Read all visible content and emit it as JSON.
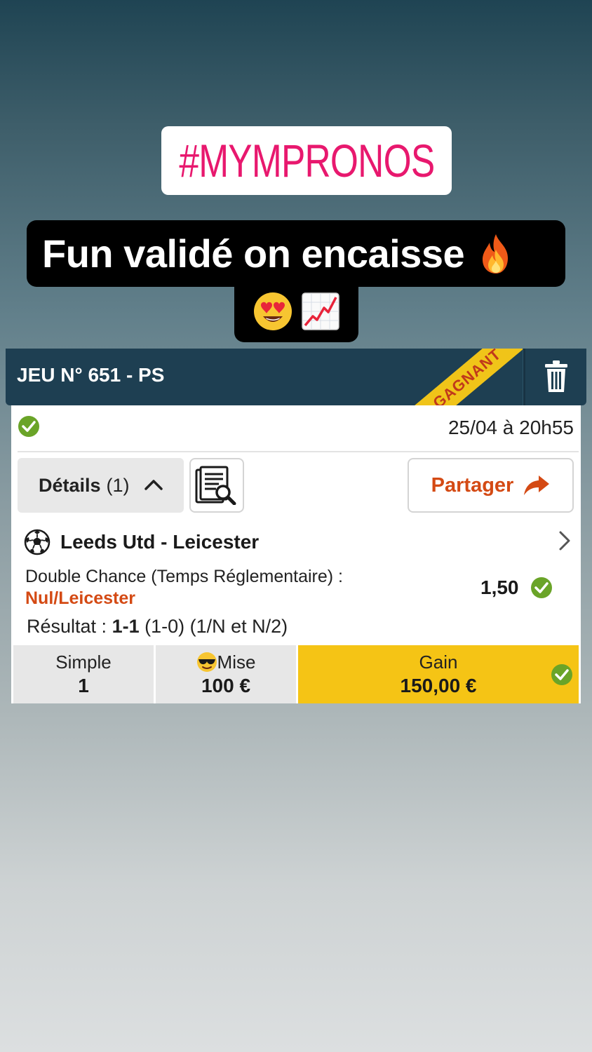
{
  "story": {
    "hashtag": "#MYMPRONOS",
    "caption_line1": "Fun validé on encaisse",
    "caption_line1_emoji": "fire-emoji",
    "caption_line2_emojis": [
      "heart-eyes-emoji",
      "chart-increasing-emoji"
    ]
  },
  "bet": {
    "title": "JEU N° 651 - PS",
    "status_ribbon": "GAGNANT",
    "datetime": "25/04 à 20h55",
    "details_label": "Détails",
    "details_count": "(1)",
    "share_label": "Partager",
    "match": {
      "name": "Leeds Utd - Leicester",
      "sport_icon": "soccer-ball-icon",
      "market": "Double Chance (Temps Réglementaire) :",
      "selection": "Nul/Leicester",
      "odds": "1,50",
      "result_label": "Résultat : ",
      "result_score": "1-1",
      "result_detail": " (1-0) (1/N et N/2)"
    },
    "footer": {
      "type_label": "Simple",
      "type_value": "1",
      "stake_label": "Mise",
      "stake_value": "100 €",
      "gain_label": "Gain",
      "gain_value": "150,00 €"
    }
  },
  "colors": {
    "brand_dark": "#1e3f52",
    "accent_orange": "#d44a14",
    "win_yellow": "#f5c415",
    "check_green": "#6aa428",
    "hashtag_pink": "#e8186e"
  }
}
